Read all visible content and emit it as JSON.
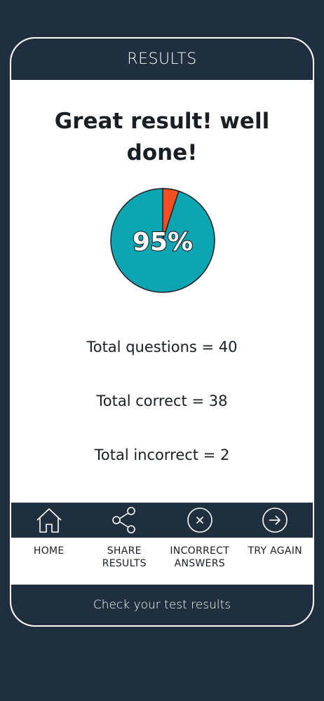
{
  "header": {
    "title": "RESULTS"
  },
  "headline": "Great result! well done!",
  "score": {
    "percent_label": "95%",
    "correct_fraction": 0.95,
    "colors": {
      "correct": "#0ea5b3",
      "incorrect": "#f24e22"
    }
  },
  "stats": {
    "total_questions": "Total questions = 40",
    "total_correct": "Total correct = 38",
    "total_incorrect": "Total incorrect = 2"
  },
  "nav": {
    "home": {
      "label": "HOME",
      "icon": "home-icon"
    },
    "share": {
      "label": "SHARE\nRESULTS",
      "icon": "share-icon"
    },
    "incorrect": {
      "label": "INCORRECT\nANSWERS",
      "icon": "close-circle-icon"
    },
    "try_again": {
      "label": "TRY AGAIN",
      "icon": "arrow-right-circle-icon"
    }
  },
  "footer": {
    "text": "Check your test results"
  }
}
